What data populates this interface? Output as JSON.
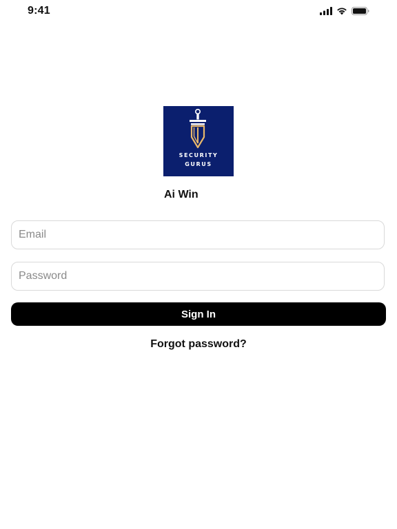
{
  "status_bar": {
    "time": "9:41",
    "icons": [
      "cellular-signal-icon",
      "wifi-icon",
      "battery-icon"
    ]
  },
  "logo": {
    "line1": "SECURITY",
    "line2": "GURUS",
    "background": "#0b1f6e",
    "accent": "#e8b86b"
  },
  "brand": {
    "name": "Ai Win"
  },
  "form": {
    "email_placeholder": "Email",
    "email_value": "",
    "password_placeholder": "Password",
    "password_value": "",
    "signin_label": "Sign In",
    "forgot_label": "Forgot password?"
  }
}
